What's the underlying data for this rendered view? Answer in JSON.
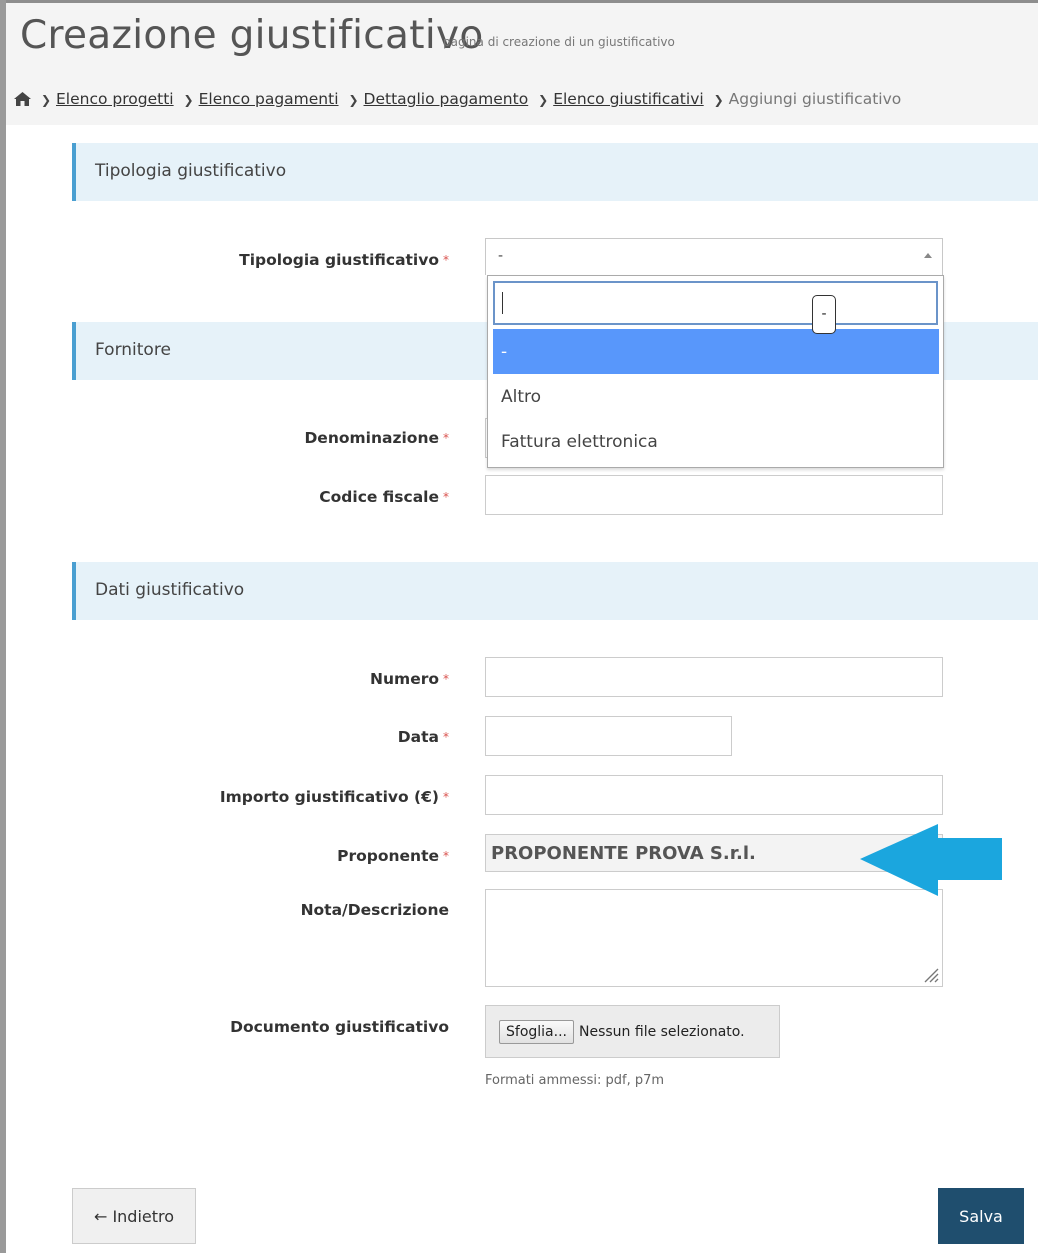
{
  "header": {
    "title": "Creazione giustificativo",
    "subtitle": "pagina di creazione di un giustificativo"
  },
  "breadcrumb": {
    "home_icon": "home-icon",
    "items": [
      "Elenco progetti",
      "Elenco pagamenti",
      "Dettaglio pagamento",
      "Elenco giustificativi"
    ],
    "current": "Aggiungi giustificativo"
  },
  "sections": {
    "tipologia": "Tipologia giustificativo",
    "fornitore": "Fornitore",
    "dati": "Dati giustificativo"
  },
  "fields": {
    "tipologia_label": "Tipologia giustificativo",
    "tipologia_value": "-",
    "denominazione_label": "Denominazione",
    "codice_fiscale_label": "Codice fiscale",
    "numero_label": "Numero",
    "data_label": "Data",
    "importo_label": "Importo giustificativo (€)",
    "proponente_label": "Proponente",
    "proponente_value": "PROPONENTE PROVA S.r.l.",
    "nota_label": "Nota/Descrizione",
    "documento_label": "Documento giustificativo",
    "required_mark": "*"
  },
  "dropdown": {
    "search_value": "",
    "options": [
      "-",
      "Altro",
      "Fattura elettronica"
    ],
    "highlighted_index": 0,
    "cursor_glyph": "-"
  },
  "file_input": {
    "button_label": "Sfoglia...",
    "status_text": "Nessun file selezionato.",
    "help_text": "Formati ammessi: pdf, p7m"
  },
  "buttons": {
    "back_label": "← Indietro",
    "save_label": "Salva"
  },
  "colors": {
    "section_bg": "#e6f2f9",
    "section_accent": "#4a9fd1",
    "highlight": "#5897fb",
    "save_bg": "#1f4e6e",
    "arrow": "#1ba6de",
    "required": "#d9534f"
  }
}
